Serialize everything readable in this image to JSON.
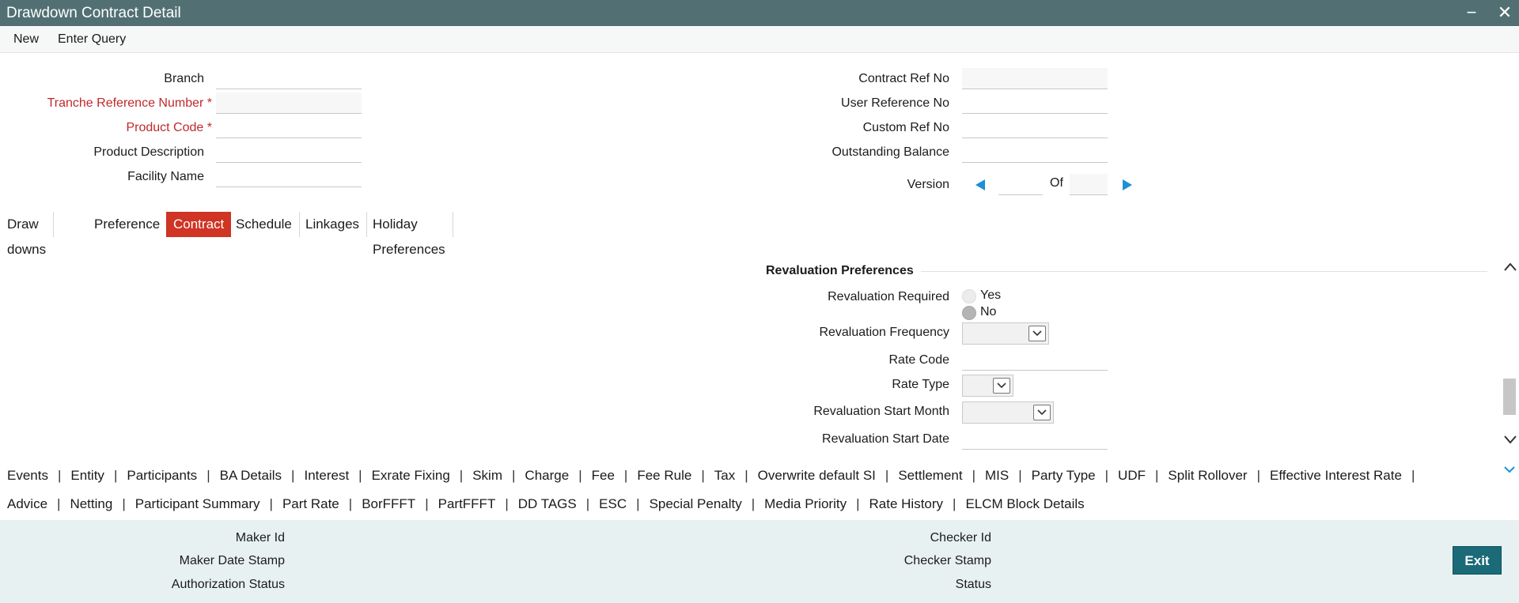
{
  "window": {
    "title": "Drawdown Contract Detail"
  },
  "menu": {
    "new": "New",
    "enter_query": "Enter Query"
  },
  "header_left": {
    "branch": "Branch",
    "tranche_ref": "Tranche Reference Number",
    "product_code": "Product Code",
    "product_description": "Product Description",
    "facility_name": "Facility Name",
    "required_mark": "*"
  },
  "header_right": {
    "contract_ref": "Contract Ref No",
    "user_ref": "User Reference No",
    "custom_ref": "Custom Ref No",
    "outstanding_balance": "Outstanding Balance",
    "version": "Version",
    "of": "Of"
  },
  "tabs": [
    "Draw downs",
    "Preference",
    "Contract",
    "Schedule",
    "Linkages",
    "Holiday Preferences"
  ],
  "active_tab": "Contract",
  "revaluation": {
    "section_title": "Revaluation Preferences",
    "required_label": "Revaluation Required",
    "yes": "Yes",
    "no": "No",
    "frequency_label": "Revaluation Frequency",
    "rate_code_label": "Rate Code",
    "rate_type_label": "Rate Type",
    "start_month_label": "Revaluation Start Month",
    "start_date_label": "Revaluation Start Date"
  },
  "links_row1": [
    "Events",
    "Entity",
    "Participants",
    "BA Details",
    "Interest",
    "Exrate Fixing",
    "Skim",
    "Charge",
    "Fee",
    "Fee Rule",
    "Tax",
    "Overwrite default SI",
    "Settlement",
    "MIS",
    "Party Type",
    "UDF",
    "Split Rollover",
    "Effective Interest Rate"
  ],
  "links_row2": [
    "Advice",
    "Netting",
    "Participant Summary",
    "Part Rate",
    "BorFFFT",
    "PartFFFT",
    "DD TAGS",
    "ESC",
    "Special Penalty",
    "Media Priority",
    "Rate History",
    "ELCM Block Details"
  ],
  "separator": "|",
  "footer": {
    "maker_id": "Maker Id",
    "maker_date_stamp": "Maker Date Stamp",
    "authorization_status": "Authorization Status",
    "checker_id": "Checker Id",
    "checker_stamp": "Checker Stamp",
    "status": "Status",
    "exit": "Exit"
  },
  "colors": {
    "titlebar": "#527073",
    "active_tab": "#cf3424",
    "required": "#c0292b",
    "footer_bg": "#e8f1f2",
    "exit_button": "#1b6a78",
    "nav_arrow": "#1d8fd6"
  }
}
